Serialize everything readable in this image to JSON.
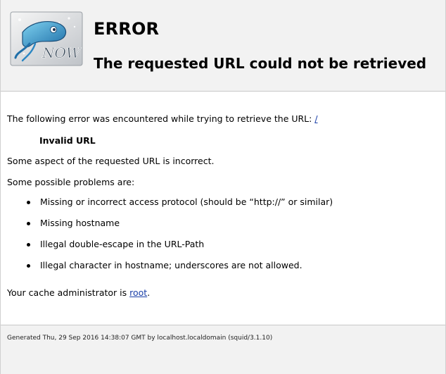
{
  "header": {
    "logo_icon": "squid-now-logo",
    "logo_text": "NOW",
    "title": "ERROR",
    "subtitle": "The requested URL could not be retrieved"
  },
  "content": {
    "intro_text": "The following error was encountered while trying to retrieve the URL: ",
    "url_link": "/",
    "error_name": "Invalid URL",
    "aspect_text": "Some aspect of the requested URL is incorrect.",
    "problems_heading": "Some possible problems are:",
    "problems": [
      "Missing or incorrect access protocol (should be “http://” or similar)",
      "Missing hostname",
      "Illegal double-escape in the URL-Path",
      "Illegal character in hostname; underscores are not allowed."
    ],
    "admin_text_before": "Your cache administrator is ",
    "admin_link": "root",
    "admin_text_after": "."
  },
  "footer": {
    "generated_text": "Generated Thu, 29 Sep 2016 14:38:07 GMT by localhost.localdomain (squid/3.1.10)"
  },
  "colors": {
    "link": "#1a3fa8",
    "header_bg": "#f2f2f2"
  }
}
